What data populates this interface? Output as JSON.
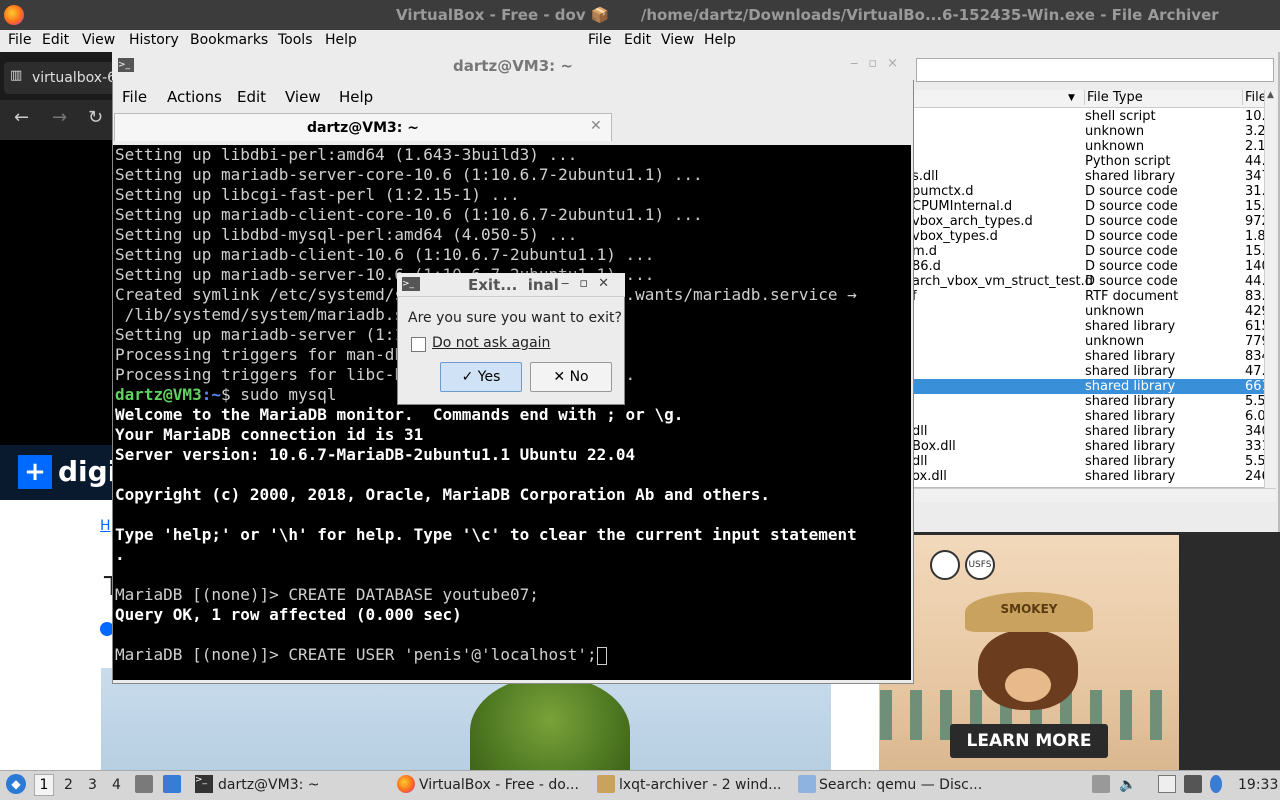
{
  "firefox": {
    "menu": [
      "File",
      "Edit",
      "View",
      "History",
      "Bookmarks",
      "Tools",
      "Help"
    ],
    "tab_label": "virtualbox-6",
    "page_logo_text": "digi",
    "page_link_frag": "H",
    "page_title_frag": "T",
    "ad": {
      "hat_text": "SMOKEY",
      "seal_text": "USFS",
      "cta": "LEARN MORE"
    }
  },
  "titlebar": {
    "text": "VirtualBox - Free - dov 📦      /home/dartz/Downloads/VirtualBo...6-152435-Win.exe - File Archiver"
  },
  "archiver": {
    "menu": [
      "File",
      "Edit",
      "View",
      "Help"
    ],
    "columns": [
      "File Type",
      "File"
    ],
    "rows": [
      {
        "name": "",
        "type": "shell script",
        "size": "10."
      },
      {
        "name": "",
        "type": "unknown",
        "size": "3.2"
      },
      {
        "name": "",
        "type": "unknown",
        "size": "2.1"
      },
      {
        "name": "",
        "type": "Python script",
        "size": "44."
      },
      {
        "name": "s.dll",
        "type": "shared library",
        "size": "347"
      },
      {
        "name": "pumctx.d",
        "type": "D source code",
        "size": "31."
      },
      {
        "name": "CPUMInternal.d",
        "type": "D source code",
        "size": "15."
      },
      {
        "name": "vbox_arch_types.d",
        "type": "D source code",
        "size": "972"
      },
      {
        "name": "vbox_types.d",
        "type": "D source code",
        "size": "1.8"
      },
      {
        "name": "m.d",
        "type": "D source code",
        "size": "15."
      },
      {
        "name": "86.d",
        "type": "D source code",
        "size": "140"
      },
      {
        "name": "arch_vbox_vm_struct_test.d",
        "type": "D source code",
        "size": "44."
      },
      {
        "name": "f",
        "type": "RTF document",
        "size": "83."
      },
      {
        "name": "",
        "type": "unknown",
        "size": "429"
      },
      {
        "name": "",
        "type": "shared library",
        "size": "615"
      },
      {
        "name": "",
        "type": "unknown",
        "size": "779"
      },
      {
        "name": "",
        "type": "shared library",
        "size": "834"
      },
      {
        "name": "",
        "type": "shared library",
        "size": "47."
      },
      {
        "name": "",
        "type": "shared library",
        "size": "661",
        "selected": true
      },
      {
        "name": "",
        "type": "shared library",
        "size": "5.5"
      },
      {
        "name": "",
        "type": "shared library",
        "size": "6.0"
      },
      {
        "name": "dll",
        "type": "shared library",
        "size": "340"
      },
      {
        "name": "Box.dll",
        "type": "shared library",
        "size": "331"
      },
      {
        "name": "dll",
        "type": "shared library",
        "size": "5.5"
      },
      {
        "name": "ox.dll",
        "type": "shared library",
        "size": "246"
      }
    ]
  },
  "terminal": {
    "title": "dartz@VM3: ~",
    "menu": [
      "File",
      "Actions",
      "Edit",
      "View",
      "Help"
    ],
    "tab_label": "dartz@VM3: ~",
    "lines": [
      "Setting up libdbi-perl:amd64 (1.643-3build3) ...",
      "Setting up mariadb-server-core-10.6 (1:10.6.7-2ubuntu1.1) ...",
      "Setting up libcgi-fast-perl (1:2.15-1) ...",
      "Setting up mariadb-client-core-10.6 (1:10.6.7-2ubuntu1.1) ...",
      "Setting up libdbd-mysql-perl:amd64 (4.050-5) ...",
      "Setting up mariadb-client-10.6 (1:10.6.7-2ubuntu1.1) ...",
      "Setting up mariadb-server-10.6 (1:10.6.7-2ubuntu1.1) ...",
      "Created symlink /etc/systemd/system/multi-user.target.wants/mariadb.service →",
      " /lib/systemd/system/mariadb.service.",
      "Setting up mariadb-server (1:10.6.7-2ubuntu1.1) ...",
      "Processing triggers for man-db (2.10.2-1) ...",
      "Processing triggers for libc-bin (2.35-0ubuntu3.1) ..."
    ],
    "prompt_user": "dartz@VM3",
    "prompt_path": ":~",
    "prompt_cmd": "$ sudo mysql",
    "welcome": [
      "Welcome to the MariaDB monitor.  Commands end with ; or \\g.",
      "Your MariaDB connection id is 31",
      "Server version: 10.6.7-MariaDB-2ubuntu1.1 Ubuntu 22.04",
      "",
      "Copyright (c) 2000, 2018, Oracle, MariaDB Corporation Ab and others.",
      "",
      "Type 'help;' or '\\h' for help. Type '\\c' to clear the current input statement",
      "."
    ],
    "sql1": "MariaDB [(none)]> CREATE DATABASE youtube07;",
    "result1": "Query OK, 1 row affected (0.000 sec)",
    "sql2": "MariaDB [(none)]> CREATE USER 'penis'@'localhost';"
  },
  "dialog": {
    "title": "Exit...  inal",
    "question": "Are you sure you want to exit?",
    "checkbox_label": "Do not ask again",
    "yes_label": "✓ Yes",
    "no_label": "✕ No"
  },
  "taskbar": {
    "workspaces": [
      "1",
      "2",
      "3",
      "4"
    ],
    "items": [
      "dartz@VM3: ~",
      "VirtualBox - Free - do...",
      "lxqt-archiver - 2 wind...",
      "Search: qemu — Disc..."
    ],
    "clock": "19:33"
  }
}
